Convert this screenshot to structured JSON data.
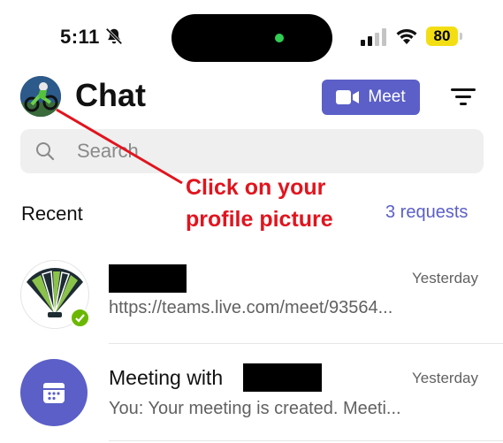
{
  "status_bar": {
    "time": "5:11",
    "battery": "80",
    "icons": [
      "bell-slash-icon",
      "cellular-signal-icon",
      "wifi-icon",
      "battery-icon"
    ]
  },
  "header": {
    "title": "Chat",
    "meet_label": "Meet",
    "icons": [
      "avatar",
      "video-camera-icon",
      "filter-icon"
    ]
  },
  "search": {
    "placeholder": "Search"
  },
  "annotation": {
    "line1": "Click on your",
    "line2": "profile picture",
    "color": "#e1141e"
  },
  "recent": {
    "heading": "Recent",
    "requests": "3 requests"
  },
  "chats": [
    {
      "time": "Yesterday",
      "preview": "https://teams.live.com/meet/93564..."
    },
    {
      "name_prefix": "Meeting with",
      "time": "Yesterday",
      "preview": "You: Your meeting is created. Meeti..."
    }
  ],
  "colors": {
    "accent": "#5b5fc7",
    "presence_available": "#6bb700",
    "battery": "#f3de14"
  }
}
